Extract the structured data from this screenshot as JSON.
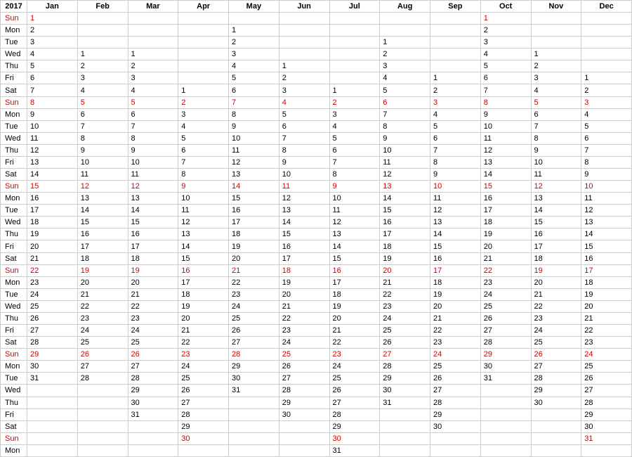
{
  "year": "2017",
  "months": [
    "Jan",
    "Feb",
    "Mar",
    "Apr",
    "May",
    "Jun",
    "Jul",
    "Aug",
    "Sep",
    "Oct",
    "Nov",
    "Dec"
  ],
  "days": [
    "Sun",
    "Mon",
    "Tue",
    "Wed",
    "Thu",
    "Fri",
    "Sat"
  ],
  "month_start_dow": [
    0,
    3,
    3,
    6,
    1,
    4,
    6,
    2,
    5,
    0,
    3,
    5
  ],
  "month_len": [
    31,
    28,
    31,
    30,
    31,
    30,
    31,
    31,
    30,
    31,
    30,
    31
  ]
}
